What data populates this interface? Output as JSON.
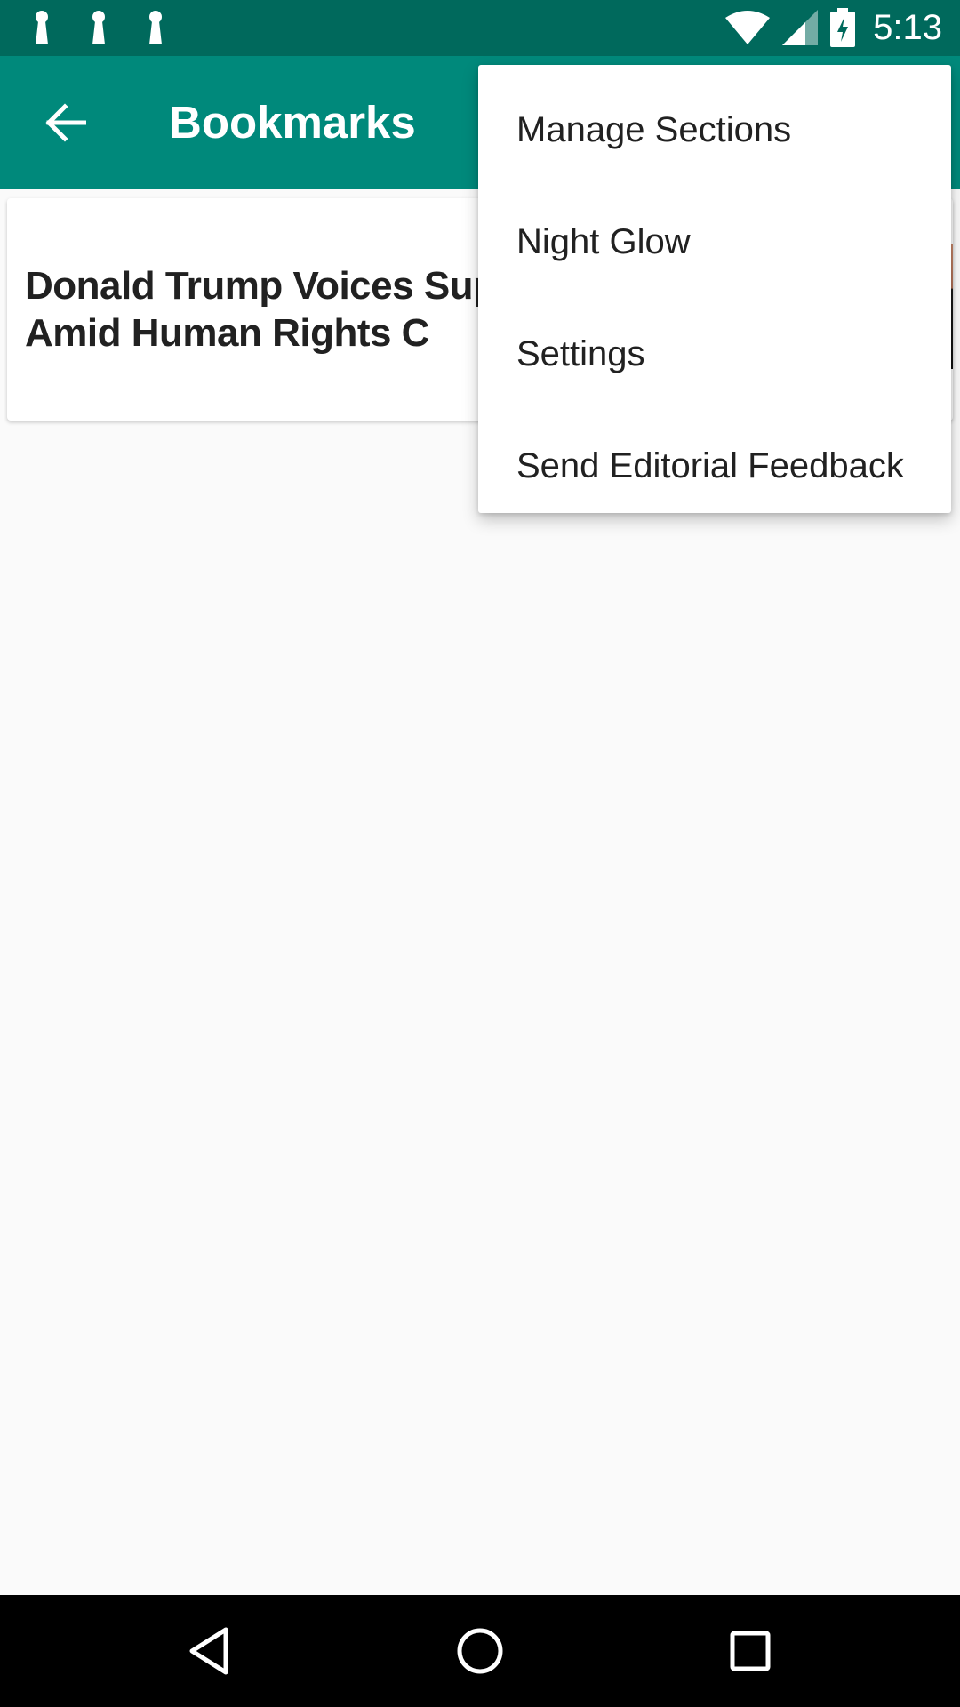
{
  "status_bar": {
    "time": "5:13",
    "icons": [
      "keyhole-icon",
      "keyhole-icon",
      "keyhole-icon",
      "wifi-icon",
      "cell-signal-icon",
      "battery-charging-icon"
    ]
  },
  "app_bar": {
    "title": "Bookmarks",
    "back_icon": "arrow-back-icon"
  },
  "bookmarks": [
    {
      "headline": "Donald Trump Voices Sup Sisi Amid Human Rights C"
    }
  ],
  "overflow_menu": {
    "items": [
      {
        "label": "Manage Sections"
      },
      {
        "label": "Night Glow"
      },
      {
        "label": "Settings"
      },
      {
        "label": "Send Editorial Feedback"
      }
    ]
  },
  "nav_bar": {
    "icons": [
      "back-triangle-icon",
      "home-circle-icon",
      "recents-square-icon"
    ]
  },
  "colors": {
    "status_bar": "#00695c",
    "app_bar": "#00897b",
    "background": "#fafafa"
  }
}
